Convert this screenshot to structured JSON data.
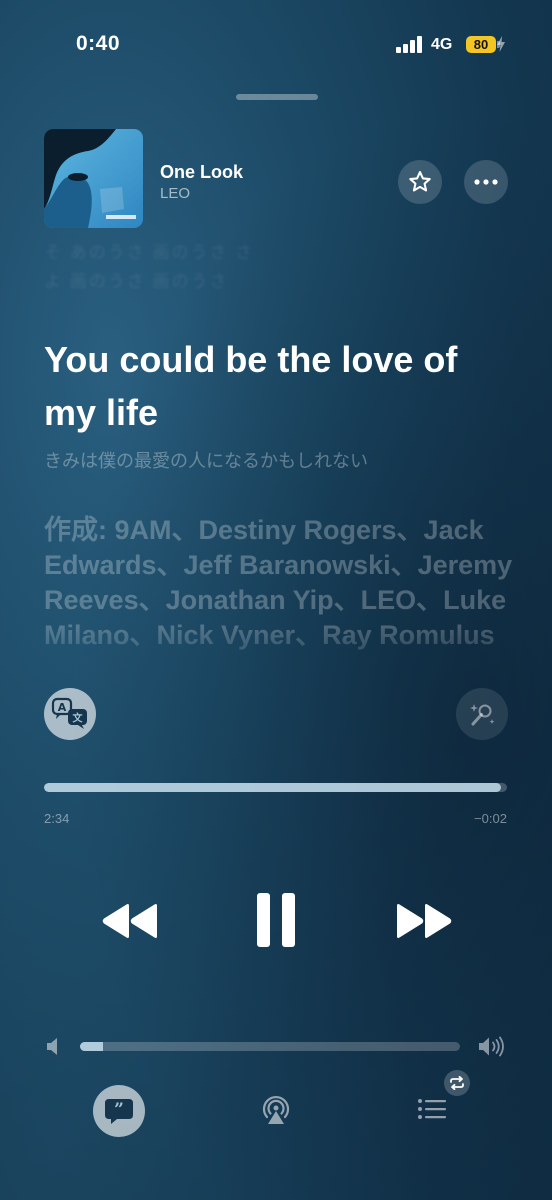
{
  "status_bar": {
    "time": "0:40",
    "network": "4G",
    "battery": "80",
    "battery_color": "#f3c623"
  },
  "now_playing": {
    "title": "One Look",
    "artist": "LEO",
    "artwork_text": "One Look"
  },
  "header_buttons": {
    "favorite_icon": "star-icon",
    "more_icon": "ellipsis-icon"
  },
  "lyrics": {
    "previous_line_1": "そ あのうさ 画のうさ さ",
    "previous_line_2": "よ 画のうさ 画のうさ",
    "current": "You could be the love of my life",
    "translation": "きみは僕の最愛の人になるかもしれない",
    "credits": "作成: 9AM、Destiny Rogers、Jack Edwards、Jeff Baranowski、Jeremy Reeves、Jonathan Yip、LEO、Luke Milano、Nick Vyner、Ray Romulus"
  },
  "playback": {
    "elapsed": "2:34",
    "remaining": "−0:02",
    "progress": 0.987
  },
  "volume": {
    "level": 0.06
  },
  "accent_color": "#bcd6e6"
}
